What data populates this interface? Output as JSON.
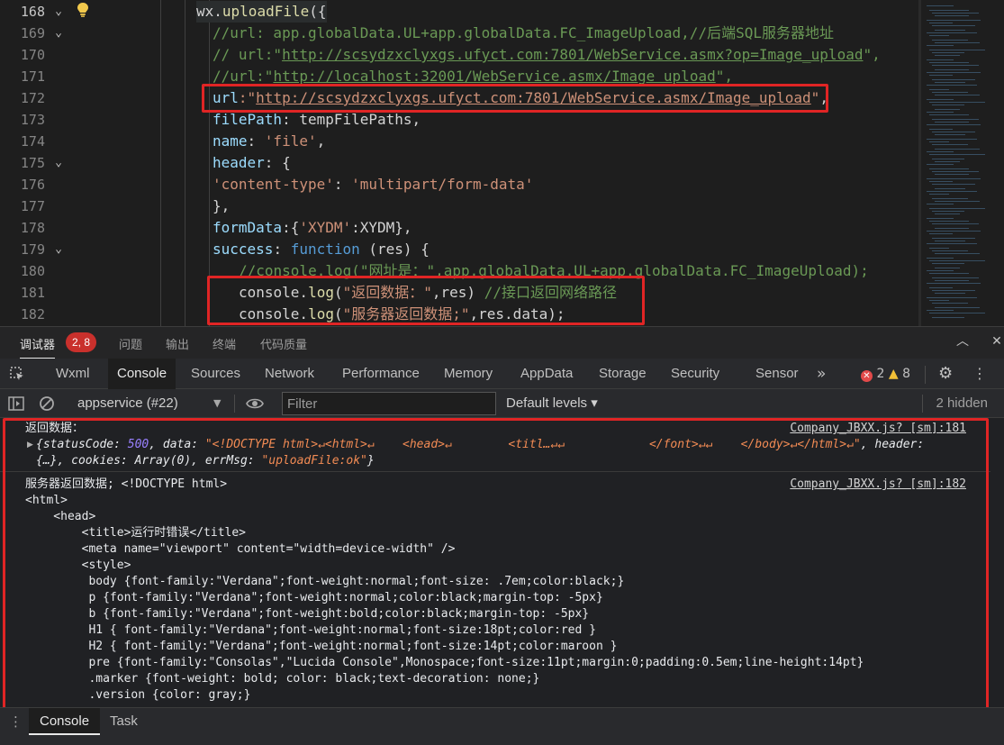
{
  "editor": {
    "line_numbers": [
      "168",
      "169",
      "170",
      "171",
      "172",
      "173",
      "174",
      "175",
      "176",
      "177",
      "178",
      "179",
      "180",
      "181",
      "182"
    ],
    "lines": [
      [
        {
          "t": "wx.",
          "c": "df"
        },
        {
          "t": "uploadFile",
          "c": "fn"
        },
        {
          "t": "({",
          "c": "df"
        }
      ],
      [
        {
          "t": "//url: app.globalData.UL+app.globalData.FC_ImageUpload,//后端SQL服务器地址",
          "c": "cm"
        }
      ],
      [
        {
          "t": "// url:\"",
          "c": "cm"
        },
        {
          "t": "http://scsydzxclyxgs.ufyct.com:7801/WebService.asmx?op=Image_upload",
          "c": "cm-u"
        },
        {
          "t": "\",",
          "c": "cm"
        }
      ],
      [
        {
          "t": "//url:\"",
          "c": "cm"
        },
        {
          "t": "http://localhost:32001/WebService.asmx/Image_upload",
          "c": "cm-u"
        },
        {
          "t": "\",",
          "c": "cm"
        }
      ],
      [
        {
          "t": "url",
          "c": "pr"
        },
        {
          "t": ":\"",
          "c": "st"
        },
        {
          "t": "http://scsydzxclyxgs.ufyct.com:7801/WebService.asmx/Image_upload",
          "c": "url"
        },
        {
          "t": "\"",
          "c": "st"
        },
        {
          "t": ",",
          "c": "df"
        }
      ],
      [
        {
          "t": "filePath",
          "c": "pr"
        },
        {
          "t": ": tempFilePaths,",
          "c": "df"
        }
      ],
      [
        {
          "t": "name",
          "c": "pr"
        },
        {
          "t": ": ",
          "c": "df"
        },
        {
          "t": "'file'",
          "c": "st"
        },
        {
          "t": ",",
          "c": "df"
        }
      ],
      [
        {
          "t": "header",
          "c": "pr"
        },
        {
          "t": ": {",
          "c": "df"
        }
      ],
      [
        {
          "t": "'content-type'",
          "c": "st"
        },
        {
          "t": ": ",
          "c": "df"
        },
        {
          "t": "'multipart/form-data'",
          "c": "st"
        }
      ],
      [
        {
          "t": "},",
          "c": "df"
        }
      ],
      [
        {
          "t": "formData",
          "c": "pr"
        },
        {
          "t": ":{",
          "c": "df"
        },
        {
          "t": "'XYDM'",
          "c": "st"
        },
        {
          "t": ":XYDM},",
          "c": "df"
        }
      ],
      [
        {
          "t": "success",
          "c": "pr"
        },
        {
          "t": ": ",
          "c": "df"
        },
        {
          "t": "function",
          "c": "kw"
        },
        {
          "t": " (res) {",
          "c": "df"
        }
      ],
      [
        {
          "t": "//console.log(\"网址是：\",app.globalData.UL+app.globalData.FC_ImageUpload);",
          "c": "cm"
        }
      ],
      [
        {
          "t": "console.",
          "c": "df"
        },
        {
          "t": "log",
          "c": "fn"
        },
        {
          "t": "(",
          "c": "df"
        },
        {
          "t": "\"返回数据：\"",
          "c": "st"
        },
        {
          "t": ",res) ",
          "c": "df"
        },
        {
          "t": "//接口返回网络路径",
          "c": "cm"
        }
      ],
      [
        {
          "t": "console.",
          "c": "df"
        },
        {
          "t": "log",
          "c": "fn"
        },
        {
          "t": "(",
          "c": "df"
        },
        {
          "t": "\"服务器返回数据;\"",
          "c": "st"
        },
        {
          "t": ",res.data);",
          "c": "df"
        }
      ]
    ]
  },
  "panel_tabs": {
    "debugger": "调试器",
    "debugger_badge": "2, 8",
    "issues": "问题",
    "output": "输出",
    "terminal": "终端",
    "code_quality": "代码质量"
  },
  "devtools": {
    "tabs": [
      "Wxml",
      "Console",
      "Sources",
      "Network",
      "Performance",
      "Memory",
      "AppData",
      "Storage",
      "Security",
      "Sensor"
    ],
    "active_tab": "Console",
    "more": "»",
    "error_count": "2",
    "warning_count": "8"
  },
  "toolbar": {
    "context": "appservice (#22)",
    "filter_placeholder": "Filter",
    "levels": "Default levels ▾",
    "hidden": "2 hidden"
  },
  "console": {
    "msg1_label": "返回数据：",
    "msg1_source": "Company_JBXX.js? [sm]:181",
    "msg1_obj_line1": [
      {
        "t": "{statusCode: ",
        "c": "o-key"
      },
      {
        "t": "500",
        "c": "o-num"
      },
      {
        "t": ", data: ",
        "c": "o-key"
      },
      {
        "t": "\"<!DOCTYPE html>↵<html>↵    <head>↵        <titl…↵↵            </font>↵↵    </body>↵</html>↵\"",
        "c": "o-str"
      },
      {
        "t": ", header:",
        "c": "o-key"
      }
    ],
    "msg1_obj_line2": [
      {
        "t": "{…}, cookies: Array(0), errMsg: ",
        "c": "o-key"
      },
      {
        "t": "\"uploadFile:ok\"",
        "c": "o-str"
      },
      {
        "t": "}",
        "c": "o-key"
      }
    ],
    "msg2_source": "Company_JBXX.js? [sm]:182",
    "msg2_lines": [
      "服务器返回数据; <!DOCTYPE html>",
      "<html>",
      "    <head>",
      "        <title>运行时错误</title>",
      "        <meta name=\"viewport\" content=\"width=device-width\" />",
      "        <style>",
      "         body {font-family:\"Verdana\";font-weight:normal;font-size: .7em;color:black;}",
      "         p {font-family:\"Verdana\";font-weight:normal;color:black;margin-top: -5px}",
      "         b {font-family:\"Verdana\";font-weight:bold;color:black;margin-top: -5px}",
      "         H1 { font-family:\"Verdana\";font-weight:normal;font-size:18pt;color:red }",
      "         H2 { font-family:\"Verdana\";font-weight:normal;font-size:14pt;color:maroon }",
      "         pre {font-family:\"Consolas\",\"Lucida Console\",Monospace;font-size:11pt;margin:0;padding:0.5em;line-height:14pt}",
      "         .marker {font-weight: bold; color: black;text-decoration: none;}",
      "         .version {color: gray;}"
    ]
  },
  "drawer": {
    "tabs": [
      "Console",
      "Task"
    ]
  },
  "icons": {
    "bulb": "lightbulb-icon",
    "fold": "chevron-down-icon",
    "inspect": "inspect-icon",
    "sidebar": "sidebar-toggle-icon",
    "clear": "clear-console-icon",
    "eye": "eye-icon",
    "settings": "gear-icon",
    "kebab": "more-vertical-icon",
    "collapse": "chevron-up-icon",
    "close": "close-icon"
  },
  "colors": {
    "highlight_box": "#e02525",
    "error_badge": "#c9302c"
  }
}
